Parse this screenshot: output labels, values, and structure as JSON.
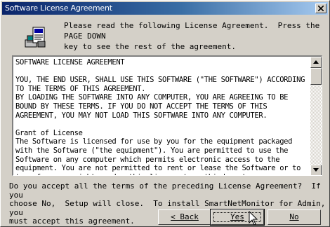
{
  "window": {
    "title": "Software License Agreement",
    "close_icon": "close-x-icon"
  },
  "header": {
    "icon": "setup-computer-license-icon",
    "instructions": "Please read the following License Agreement.  Press the PAGE DOWN\nkey to see the rest of the agreement."
  },
  "license": {
    "text": "SOFTWARE LICENSE AGREEMENT\n\nYOU, THE END USER, SHALL USE THIS SOFTWARE (\"THE SOFTWARE\") ACCORDING\nTO THE TERMS OF THIS AGREEMENT.\nBY LOADING THE SOFTWARE INTO ANY COMPUTER, YOU ARE AGREEING TO BE\nBOUND BY THESE TERMS. IF YOU DO NOT ACCEPT THE TERMS OF THIS\nAGREEMENT, YOU MAY NOT LOAD THIS SOFTWARE INTO ANY COMPUTER.\n\nGrant of License\nThe Software is licensed for use by you for the equipment packaged\nwith the Software (\"the equipment\"). You are permitted to use the\nSoftware on any computer which permits electronic access to the\nequipment. You are not permitted to rent or lease the Software or to\ntransfer your rights under this license to a third party.",
    "scroll_up_icon": "scroll-up-arrow-icon",
    "scroll_down_icon": "scroll-down-arrow-icon"
  },
  "prompt": {
    "question": "Do you accept all the terms of the preceding License Agreement?  If you\nchoose No,  Setup will close.  To install SmartNetMonitor for Admin, you\nmust accept this agreement."
  },
  "buttons": {
    "back": "< Back",
    "yes": "Yes",
    "no": "No"
  },
  "cursor": {
    "icon": "mouse-pointer-icon"
  }
}
